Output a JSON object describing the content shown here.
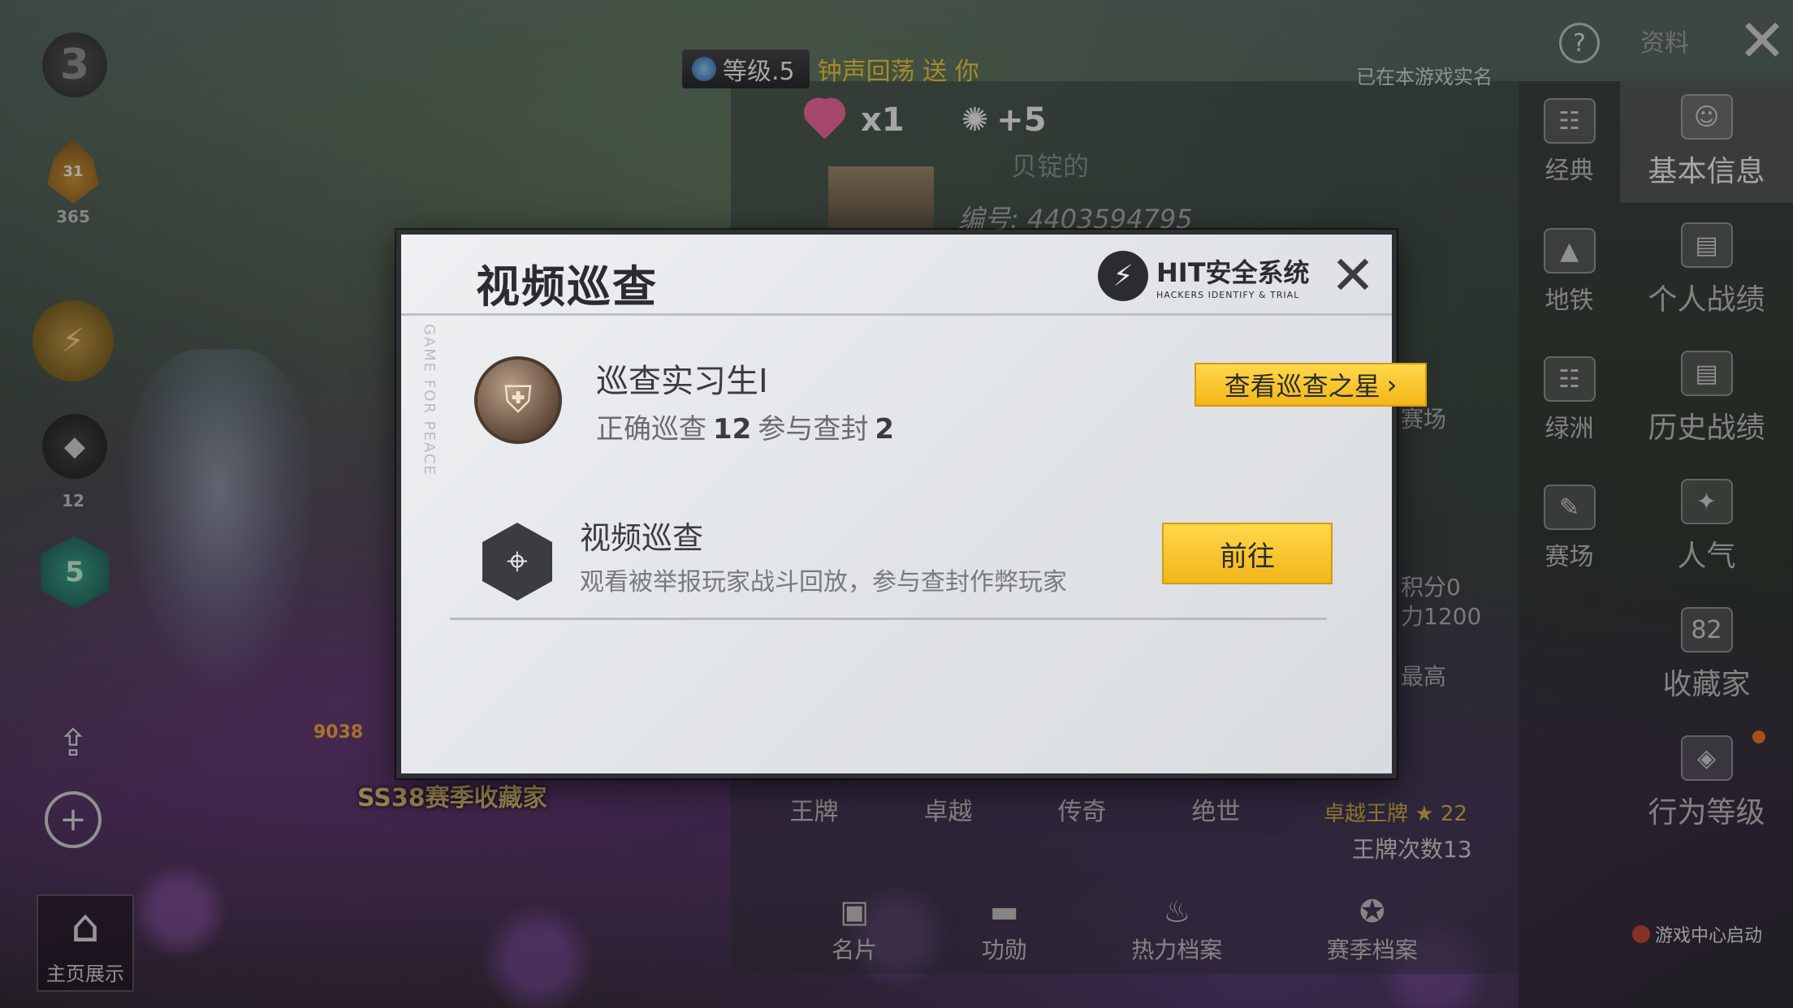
{
  "background": {
    "left": {
      "rank_number": "3",
      "flame_badge_text": "31",
      "flame_badge_num": "365",
      "shark_num": "12",
      "shield_num": "5",
      "home_label": "主页展示"
    },
    "top": {
      "level_label": "等级.5",
      "level_gift": "钟声回荡 送 你",
      "realname": "已在本游戏实名",
      "heart_count": "x1",
      "popularity": "+5",
      "help": "?",
      "close": "✕",
      "top_right_label": "资料"
    },
    "profile": {
      "name_fragment": "贝锭的",
      "id_text": "编号: 4403594795",
      "side_texts": [
        "赛场",
        "积分0",
        "力1200",
        "最高"
      ],
      "rank_tabs": [
        "王牌",
        "卓越",
        "传奇",
        "绝世"
      ],
      "ace_label": "卓越王牌",
      "ace_star": "★",
      "ace_value": "22",
      "ace_count": "王牌次数13",
      "collector": "SS38赛季收藏家",
      "score": "9038"
    },
    "bottom_nav": [
      {
        "icon": "▣",
        "label": "名片"
      },
      {
        "icon": "▬",
        "label": "功勋"
      },
      {
        "icon": "♨",
        "label": "热力档案"
      },
      {
        "icon": "✪",
        "label": "赛季档案"
      }
    ],
    "menu_col1": [
      {
        "icon": "☷",
        "label": "经典"
      },
      {
        "icon": "▲",
        "label": "地铁"
      },
      {
        "icon": "☷",
        "label": "绿洲"
      },
      {
        "icon": "✎",
        "label": "赛场"
      }
    ],
    "menu_col2": [
      {
        "icon": "☺",
        "label": "基本信息"
      },
      {
        "icon": "▤",
        "label": "个人战绩"
      },
      {
        "icon": "▤",
        "label": "历史战绩"
      },
      {
        "icon": "✦",
        "label": "人气"
      },
      {
        "icon": "82",
        "label": "收藏家"
      },
      {
        "icon": "◈",
        "label": "行为等级"
      }
    ],
    "game_center": "游戏中心启动"
  },
  "modal": {
    "title": "视频巡查",
    "side_text": "GAME FOR PEACE",
    "logo_main": "HIT安全系统",
    "logo_sub": "HACKERS IDENTIFY & TRIAL",
    "close": "✕",
    "rank": {
      "emblem": "⛨",
      "title": "巡查实习生I",
      "correct_label": "正确巡查",
      "correct_value": "12",
      "ban_label": "参与查封",
      "ban_value": "2",
      "star_button": "查看巡查之星",
      "star_arrow": "›"
    },
    "task": {
      "icon": "⌖",
      "title": "视频巡查",
      "desc": "观看被举报玩家战斗回放，参与查封作弊玩家",
      "go_button": "前往"
    }
  },
  "colors": {
    "accent_yellow": "#f2b61a",
    "modal_bg": "#e2e5e8",
    "gift_text": "#ffd43a"
  }
}
